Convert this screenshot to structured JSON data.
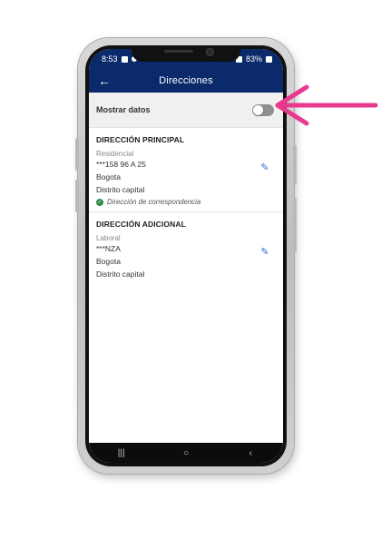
{
  "status": {
    "time": "8:53",
    "battery": "83%"
  },
  "appbar": {
    "title": "Direcciones",
    "back_icon": "arrow-left-icon"
  },
  "toggle": {
    "label": "Mostrar datos",
    "state": "off"
  },
  "main_address": {
    "heading": "DIRECCIÓN PRINCIPAL",
    "type": "Residencial",
    "street": "***158 96 A 25",
    "city": "Bogota",
    "region": "Distrito capital",
    "note": "Dirección de correspondencia"
  },
  "extra_address": {
    "heading": "DIRECCIÓN ADICIONAL",
    "type": "Laboral",
    "street": "***NZA",
    "city": "Bogota",
    "region": "Distrito capital"
  },
  "nav": {
    "recents": "|||",
    "home": "○",
    "back": "‹"
  },
  "colors": {
    "appbar": "#0b2a6b",
    "edit": "#2f6fd1",
    "check": "#2e8b43",
    "annotation_arrow": "#e8398f"
  }
}
